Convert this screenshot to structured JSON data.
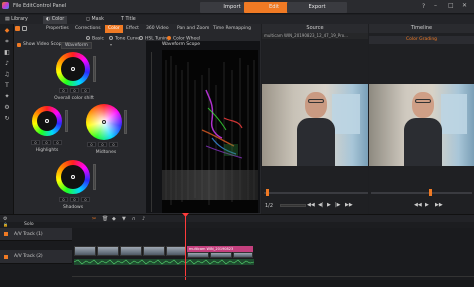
{
  "topbar": {
    "menu": [
      "File",
      "Edit",
      "Control Panel"
    ],
    "tabs": {
      "import": "Import",
      "edit": "Edit",
      "export": "Export"
    },
    "accent": "#f07a24"
  },
  "tabrow": {
    "library": "Library",
    "color": "Color",
    "mask": "Mask",
    "title": "Title"
  },
  "props_tabs": [
    "Properties",
    "Corrections",
    "Color",
    "Effect",
    "360 Video",
    "Pan and Zoom",
    "Time Remapping"
  ],
  "scope": {
    "show_label": "Show Video Scope",
    "dropdown": "Waveform",
    "panel_title": "Waveform Scope"
  },
  "modes": {
    "basic": "Basic",
    "tone_curve": "Tone Curve",
    "hsl": "HSL Tuning",
    "wheel": "Color Wheel"
  },
  "wheels": {
    "overall": "Overall color shift",
    "highlights": "Highlights",
    "midtones": "Midtones",
    "shadows": "Shadows",
    "zero": "0"
  },
  "preview_left": {
    "title": "Source",
    "filename": "multicam WIN_20190823_12_47_19_Pro..."
  },
  "preview_right": {
    "title": "Timeline",
    "subtitle": "Color Grading"
  },
  "timecode": {
    "left": "1/2"
  },
  "timeline": {
    "solo_label": "Solo",
    "track1": "A/V Track (1)",
    "track2": "A/V Track (2)",
    "clip_label": "multicam WIN_20190823"
  }
}
